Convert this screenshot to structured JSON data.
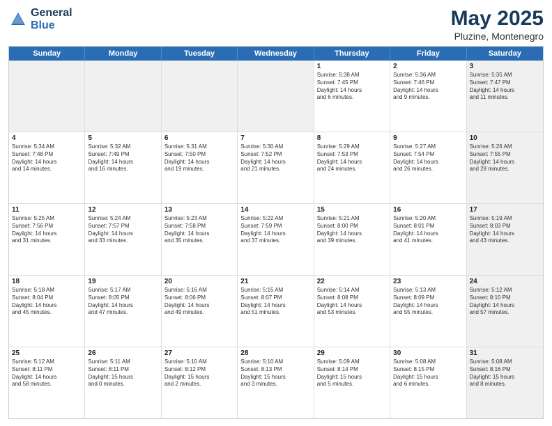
{
  "logo": {
    "line1": "General",
    "line2": "Blue"
  },
  "title": "May 2025",
  "subtitle": "Pluzine, Montenegro",
  "header_days": [
    "Sunday",
    "Monday",
    "Tuesday",
    "Wednesday",
    "Thursday",
    "Friday",
    "Saturday"
  ],
  "weeks": [
    [
      {
        "day": "",
        "info": "",
        "shaded": true
      },
      {
        "day": "",
        "info": "",
        "shaded": true
      },
      {
        "day": "",
        "info": "",
        "shaded": true
      },
      {
        "day": "",
        "info": "",
        "shaded": true
      },
      {
        "day": "1",
        "info": "Sunrise: 5:38 AM\nSunset: 7:45 PM\nDaylight: 14 hours\nand 6 minutes."
      },
      {
        "day": "2",
        "info": "Sunrise: 5:36 AM\nSunset: 7:46 PM\nDaylight: 14 hours\nand 9 minutes."
      },
      {
        "day": "3",
        "info": "Sunrise: 5:35 AM\nSunset: 7:47 PM\nDaylight: 14 hours\nand 11 minutes.",
        "shaded": true
      }
    ],
    [
      {
        "day": "4",
        "info": "Sunrise: 5:34 AM\nSunset: 7:48 PM\nDaylight: 14 hours\nand 14 minutes."
      },
      {
        "day": "5",
        "info": "Sunrise: 5:32 AM\nSunset: 7:49 PM\nDaylight: 14 hours\nand 16 minutes."
      },
      {
        "day": "6",
        "info": "Sunrise: 5:31 AM\nSunset: 7:50 PM\nDaylight: 14 hours\nand 19 minutes."
      },
      {
        "day": "7",
        "info": "Sunrise: 5:30 AM\nSunset: 7:52 PM\nDaylight: 14 hours\nand 21 minutes."
      },
      {
        "day": "8",
        "info": "Sunrise: 5:29 AM\nSunset: 7:53 PM\nDaylight: 14 hours\nand 24 minutes."
      },
      {
        "day": "9",
        "info": "Sunrise: 5:27 AM\nSunset: 7:54 PM\nDaylight: 14 hours\nand 26 minutes."
      },
      {
        "day": "10",
        "info": "Sunrise: 5:26 AM\nSunset: 7:55 PM\nDaylight: 14 hours\nand 28 minutes.",
        "shaded": true
      }
    ],
    [
      {
        "day": "11",
        "info": "Sunrise: 5:25 AM\nSunset: 7:56 PM\nDaylight: 14 hours\nand 31 minutes."
      },
      {
        "day": "12",
        "info": "Sunrise: 5:24 AM\nSunset: 7:57 PM\nDaylight: 14 hours\nand 33 minutes."
      },
      {
        "day": "13",
        "info": "Sunrise: 5:23 AM\nSunset: 7:58 PM\nDaylight: 14 hours\nand 35 minutes."
      },
      {
        "day": "14",
        "info": "Sunrise: 5:22 AM\nSunset: 7:59 PM\nDaylight: 14 hours\nand 37 minutes."
      },
      {
        "day": "15",
        "info": "Sunrise: 5:21 AM\nSunset: 8:00 PM\nDaylight: 14 hours\nand 39 minutes."
      },
      {
        "day": "16",
        "info": "Sunrise: 5:20 AM\nSunset: 8:01 PM\nDaylight: 14 hours\nand 41 minutes."
      },
      {
        "day": "17",
        "info": "Sunrise: 5:19 AM\nSunset: 8:03 PM\nDaylight: 14 hours\nand 43 minutes.",
        "shaded": true
      }
    ],
    [
      {
        "day": "18",
        "info": "Sunrise: 5:18 AM\nSunset: 8:04 PM\nDaylight: 14 hours\nand 45 minutes."
      },
      {
        "day": "19",
        "info": "Sunrise: 5:17 AM\nSunset: 8:05 PM\nDaylight: 14 hours\nand 47 minutes."
      },
      {
        "day": "20",
        "info": "Sunrise: 5:16 AM\nSunset: 8:06 PM\nDaylight: 14 hours\nand 49 minutes."
      },
      {
        "day": "21",
        "info": "Sunrise: 5:15 AM\nSunset: 8:07 PM\nDaylight: 14 hours\nand 51 minutes."
      },
      {
        "day": "22",
        "info": "Sunrise: 5:14 AM\nSunset: 8:08 PM\nDaylight: 14 hours\nand 53 minutes."
      },
      {
        "day": "23",
        "info": "Sunrise: 5:13 AM\nSunset: 8:09 PM\nDaylight: 14 hours\nand 55 minutes."
      },
      {
        "day": "24",
        "info": "Sunrise: 5:12 AM\nSunset: 8:10 PM\nDaylight: 14 hours\nand 57 minutes.",
        "shaded": true
      }
    ],
    [
      {
        "day": "25",
        "info": "Sunrise: 5:12 AM\nSunset: 8:11 PM\nDaylight: 14 hours\nand 58 minutes."
      },
      {
        "day": "26",
        "info": "Sunrise: 5:11 AM\nSunset: 8:11 PM\nDaylight: 15 hours\nand 0 minutes."
      },
      {
        "day": "27",
        "info": "Sunrise: 5:10 AM\nSunset: 8:12 PM\nDaylight: 15 hours\nand 2 minutes."
      },
      {
        "day": "28",
        "info": "Sunrise: 5:10 AM\nSunset: 8:13 PM\nDaylight: 15 hours\nand 3 minutes."
      },
      {
        "day": "29",
        "info": "Sunrise: 5:09 AM\nSunset: 8:14 PM\nDaylight: 15 hours\nand 5 minutes."
      },
      {
        "day": "30",
        "info": "Sunrise: 5:08 AM\nSunset: 8:15 PM\nDaylight: 15 hours\nand 6 minutes."
      },
      {
        "day": "31",
        "info": "Sunrise: 5:08 AM\nSunset: 8:16 PM\nDaylight: 15 hours\nand 8 minutes.",
        "shaded": true
      }
    ]
  ]
}
